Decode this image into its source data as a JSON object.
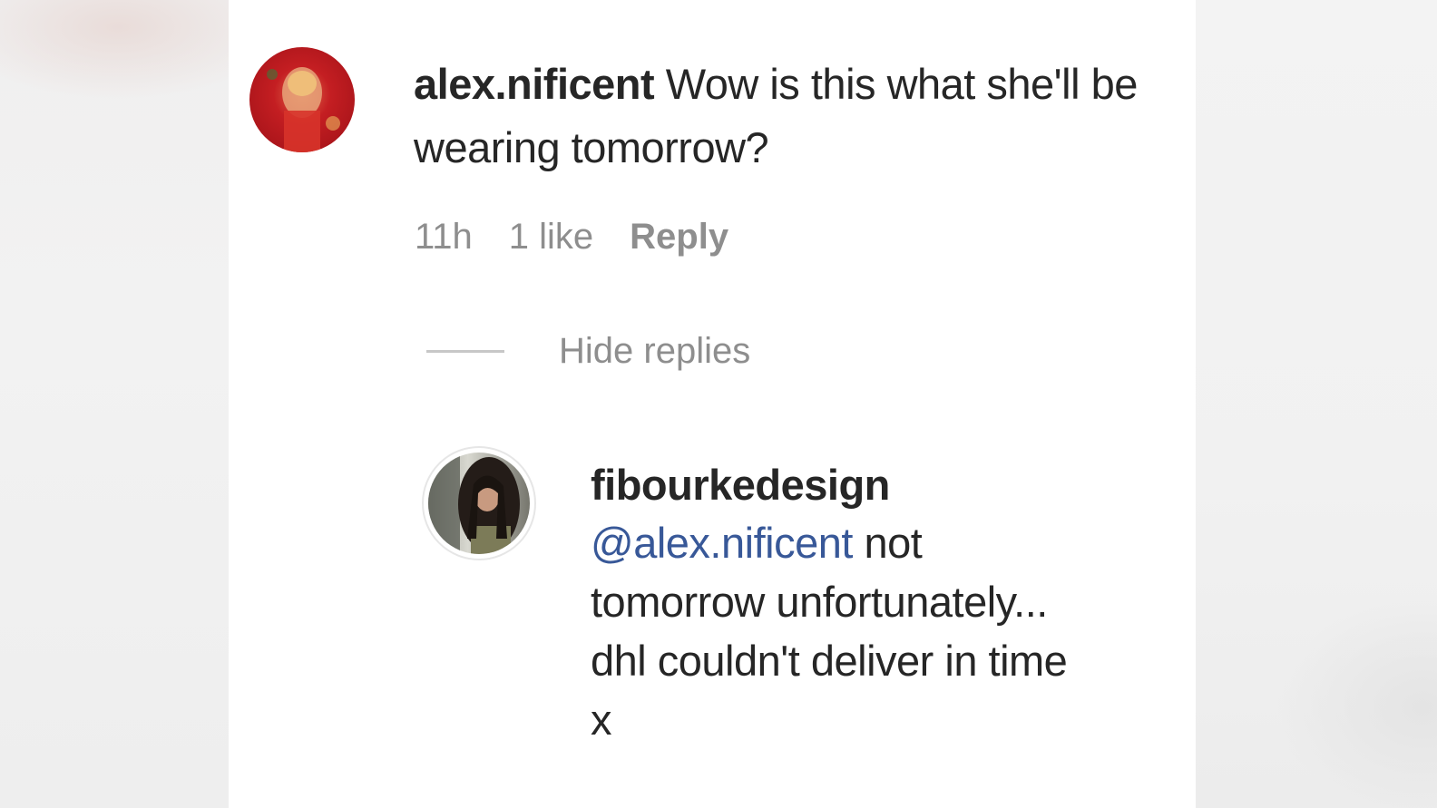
{
  "comment": {
    "username": "alex.nificent",
    "text": " Wow is this what she'll be wearing tomorrow?",
    "time": "11h",
    "likes": "1 like",
    "reply_label": "Reply"
  },
  "thread": {
    "hide_replies_label": "Hide replies"
  },
  "reply": {
    "username": "fibourkedesign",
    "mention": "@alex.nificent",
    "lines": [
      " not",
      "tomorrow unfortunately...",
      "dhl couldn't deliver in time",
      "x"
    ]
  },
  "icons": {
    "main_avatar": "profile-avatar-red",
    "reply_avatar": "profile-avatar-photo"
  },
  "colors": {
    "text": "#262626",
    "secondary": "#8e8e8e",
    "mention": "#385898"
  }
}
